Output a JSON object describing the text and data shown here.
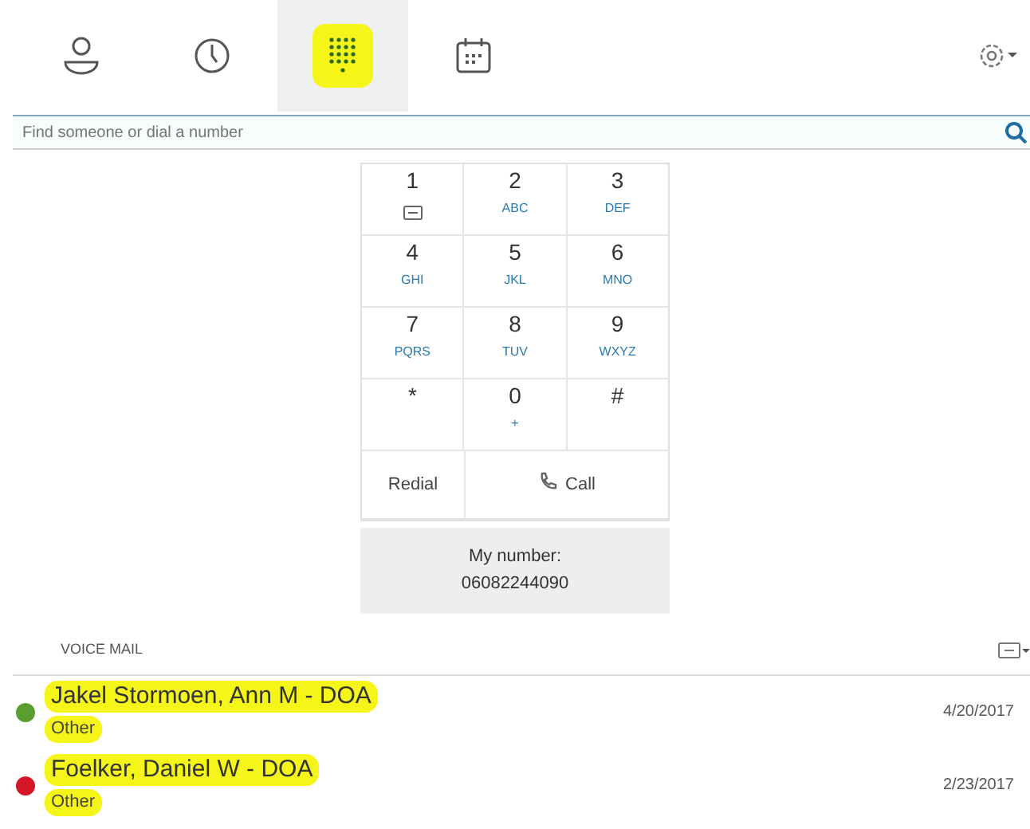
{
  "tabs": [
    {
      "kind": "contacts",
      "selected": false,
      "highlighted": false
    },
    {
      "kind": "history",
      "selected": false,
      "highlighted": false
    },
    {
      "kind": "dialpad",
      "selected": true,
      "highlighted": true
    },
    {
      "kind": "meetings",
      "selected": false,
      "highlighted": false
    }
  ],
  "search": {
    "placeholder": "Find someone or dial a number"
  },
  "dialpad": {
    "keys": [
      {
        "digit": "1",
        "kind": "voicemail"
      },
      {
        "digit": "2",
        "letters": "ABC"
      },
      {
        "digit": "3",
        "letters": "DEF"
      },
      {
        "digit": "4",
        "letters": "GHI"
      },
      {
        "digit": "5",
        "letters": "JKL"
      },
      {
        "digit": "6",
        "letters": "MNO"
      },
      {
        "digit": "7",
        "letters": "PQRS"
      },
      {
        "digit": "8",
        "letters": "TUV"
      },
      {
        "digit": "9",
        "letters": "WXYZ"
      },
      {
        "digit": "*"
      },
      {
        "digit": "0",
        "letters": "+"
      },
      {
        "digit": "#"
      }
    ],
    "redial": "Redial",
    "call": "Call",
    "my_number_label": "My number:",
    "my_number": "06082244090"
  },
  "voice_mail": {
    "title": "VOICE MAIL",
    "items": [
      {
        "name": "Jakel Stormoen, Ann M - DOA",
        "type": "Other",
        "date": "4/20/2017",
        "color": "#5a9e2f",
        "highlighted": true
      },
      {
        "name": "Foelker, Daniel W - DOA",
        "type": "Other",
        "date": "2/23/2017",
        "color": "#d41628",
        "highlighted": true
      }
    ]
  }
}
